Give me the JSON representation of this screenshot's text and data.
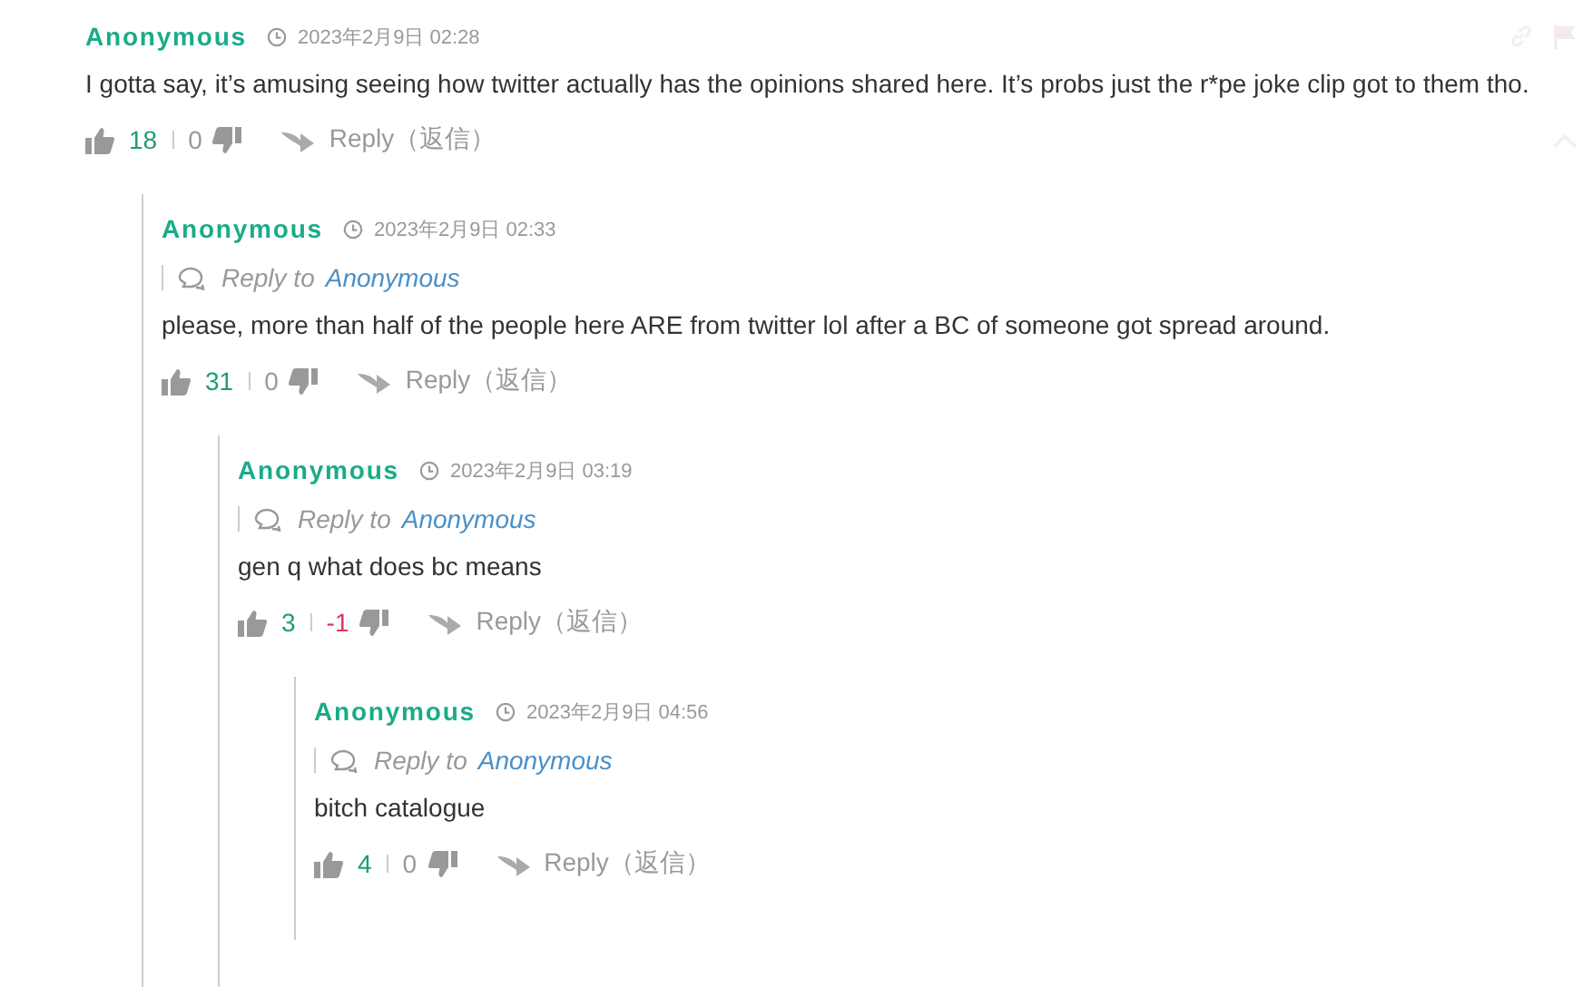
{
  "comments": [
    {
      "author": "Anonymous",
      "date": "2023年2月9日 02:28",
      "text": "I gotta say, it’s amusing seeing how twitter actually has the opinions shared here. It’s probs just the r*pe joke clip got to them tho.",
      "up": "18",
      "down": "0",
      "reply": "Reply（返信）",
      "children": [
        {
          "author": "Anonymous",
          "date": "2023年2月9日 02:33",
          "reply_to_label": "Reply to",
          "reply_to": "Anonymous",
          "text": "please, more than half of the people here ARE from twitter lol after a BC of someone got spread around.",
          "up": "31",
          "down": "0",
          "reply": "Reply（返信）",
          "children": [
            {
              "author": "Anonymous",
              "date": "2023年2月9日 03:19",
              "reply_to_label": "Reply to",
              "reply_to": "Anonymous",
              "text": "gen q what does bc means",
              "up": "3",
              "down": "-1",
              "reply": "Reply（返信）",
              "children": [
                {
                  "author": "Anonymous",
                  "date": "2023年2月9日 04:56",
                  "reply_to_label": "Reply to",
                  "reply_to": "Anonymous",
                  "text": "bitch catalogue",
                  "up": "4",
                  "down": "0",
                  "reply": "Reply（返信）"
                }
              ]
            }
          ]
        }
      ]
    }
  ]
}
